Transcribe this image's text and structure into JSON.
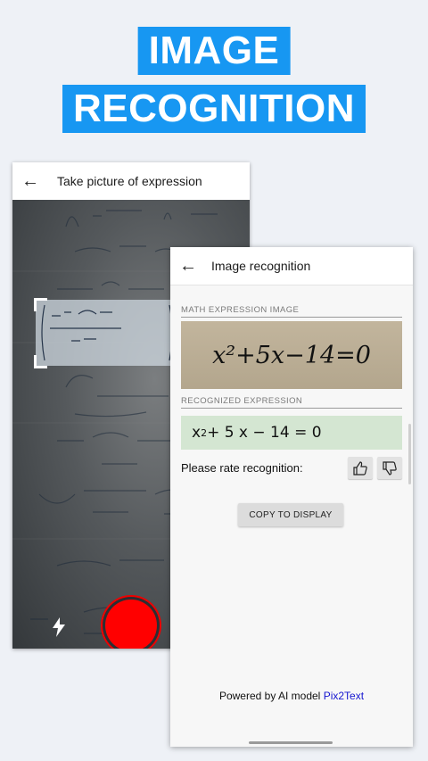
{
  "headline": {
    "line1": "IMAGE",
    "line2": "RECOGNITION"
  },
  "camera_screen": {
    "title": "Take picture of expression",
    "back_icon": "arrow-left",
    "flash_icon": "lightning-bolt"
  },
  "recognition_screen": {
    "title": "Image recognition",
    "back_icon": "arrow-left",
    "image_section_label": "MATH EXPRESSION IMAGE",
    "handwritten_expression": "x²+5x−14=0",
    "recognized_section_label": "RECOGNIZED EXPRESSION",
    "recognized_base": "x",
    "recognized_exponent": "2",
    "recognized_rest": " + 5 x − 14 = 0",
    "rate_prompt": "Please rate recognition:",
    "thumb_up_icon": "thumb-up",
    "thumb_down_icon": "thumb-down",
    "copy_button_label": "COPY TO DISPLAY",
    "powered_prefix": "Powered by AI model ",
    "powered_link": "Pix2Text"
  },
  "colors": {
    "headline_bg": "#1797f2",
    "shutter": "#ff0000",
    "recognized_bg": "#d4e6d2",
    "link": "#1515d0"
  }
}
